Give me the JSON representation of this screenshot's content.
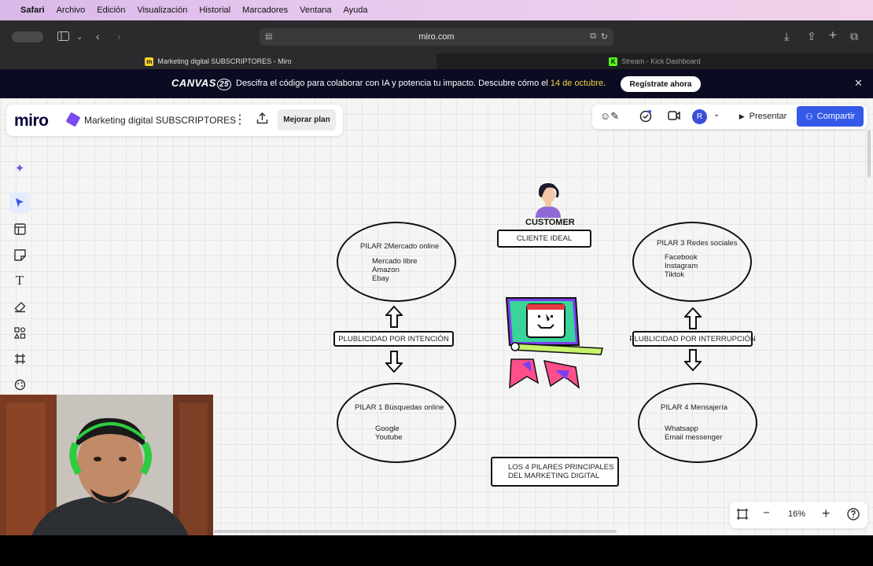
{
  "menubar": {
    "app": "Safari",
    "items": [
      "Archivo",
      "Edición",
      "Visualización",
      "Historial",
      "Marcadores",
      "Ventana",
      "Ayuda"
    ]
  },
  "toolbar": {
    "url": "miro.com"
  },
  "tabs": [
    {
      "label": "Marketing digital SUBSCRIPTORES - Miro",
      "active": true
    },
    {
      "label": "Stream - Kick Dashboard",
      "active": false
    }
  ],
  "banner": {
    "logo": "CANVAS",
    "logo_num": "25",
    "message": "Descifra el código para colaborar con IA y potencia tu impacto. Descubre cómo el ",
    "date": "14 de octubre",
    "message_end": ".",
    "cta": "Regístrate ahora"
  },
  "board": {
    "logo": "miro",
    "title": "Marketing digital SUBSCRIPTORES",
    "upgrade": "Mejorar plan"
  },
  "topright": {
    "avatar": "R",
    "present": "Presentar",
    "share": "Compartir"
  },
  "diagram": {
    "customer": "CUSTOMER",
    "cliente_ideal": "CLIENTE IDEAL",
    "pilar2": {
      "title": "PILAR 2Mercado online",
      "items": [
        "Mercado libre",
        "Amazon",
        "Ebay"
      ]
    },
    "pilar3": {
      "title": "PILAR 3 Redes sociales",
      "items": [
        "Facebook",
        "Instagram",
        "Tiktok"
      ]
    },
    "pilar1": {
      "title": "PILAR 1  Búsquedas online",
      "items": [
        "Google",
        "Youtube"
      ]
    },
    "pilar4": {
      "title": "PILAR 4   Mensajería",
      "items": [
        "Whatsapp",
        "Email messenger"
      ]
    },
    "intencion": "PLUBLICIDAD POR INTENCIÓN",
    "interrupcion": "PLUBLICIDAD POR INTERRUPCIÓN",
    "footer_line1": "LOS 4  PILARES PRINCIPALES",
    "footer_line2": "DEL MARKETING DIGITAL"
  },
  "zoom": {
    "value": "16%"
  },
  "colors": {
    "share": "#3559e9",
    "banner_bg": "#0b0c22",
    "date": "#f5d33b"
  }
}
